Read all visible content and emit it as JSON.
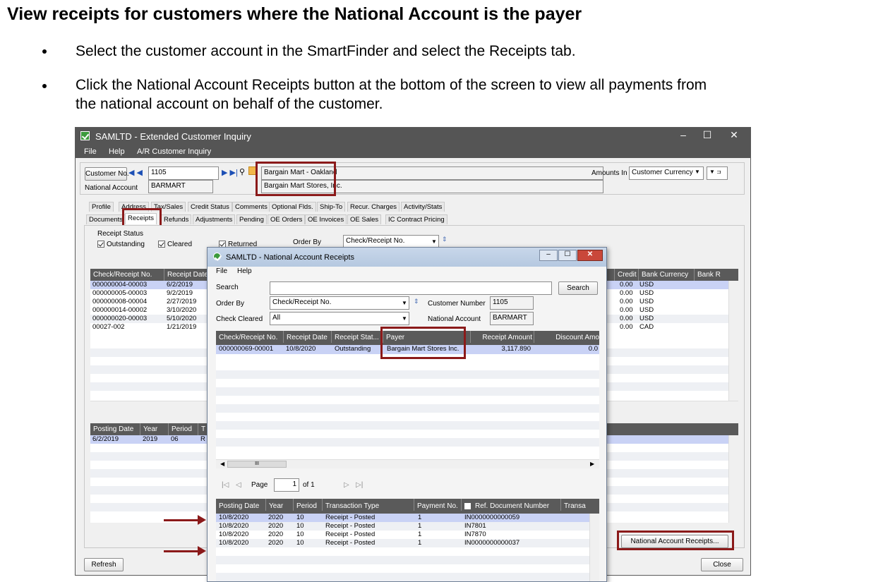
{
  "doc": {
    "title": "View receipts for customers where the National Account is the payer",
    "bullets": [
      "Select the customer account in the SmartFinder and select the Receipts tab.",
      "Click the National Account Receipts button at the bottom of the screen to view all payments from",
      "the national account on behalf of the customer."
    ]
  },
  "main": {
    "title": "SAMLTD - Extended Customer Inquiry",
    "menu": [
      "File",
      "Help",
      "A/R Customer Inquiry"
    ],
    "customer_no_label": "Customer No.",
    "customer_no": "1105",
    "customer_name": "Bargain Mart - Oakland",
    "national_account_label": "National Account",
    "national_account": "BARMART",
    "national_account_name": "Bargain Mart Stores, Inc.",
    "amounts_in_label": "Amounts In",
    "amounts_in": "Customer Currency",
    "tabs_row1": [
      "Profile",
      "Address",
      "Tax/Sales",
      "Credit Status",
      "Comments",
      "Optional Flds.",
      "Ship-To",
      "Recur. Charges",
      "Activity/Stats"
    ],
    "tabs_row2": [
      "Documents",
      "Receipts",
      "Refunds",
      "Adjustments",
      "Pending",
      "OE Orders",
      "OE Invoices",
      "OE Sales",
      "IC Contract Pricing"
    ],
    "receipt_status_label": "Receipt Status",
    "status_checks": [
      "Outstanding",
      "Cleared",
      "Returned"
    ],
    "order_by_label": "Order By",
    "order_by": "Check/Receipt No.",
    "grid_headers": [
      "Check/Receipt No.",
      "Receipt Date"
    ],
    "grid_headers_right": [
      "Credit",
      "Bank Currency",
      "Bank R"
    ],
    "receipts": [
      {
        "no": "000000004-00003",
        "date": "6/2/2019",
        "credit": "0.00",
        "currency": "USD"
      },
      {
        "no": "000000005-00003",
        "date": "9/2/2019",
        "credit": "0.00",
        "currency": "USD"
      },
      {
        "no": "000000008-00004",
        "date": "2/27/2019",
        "credit": "0.00",
        "currency": "USD"
      },
      {
        "no": "000000014-00002",
        "date": "3/10/2020",
        "credit": "0.00",
        "currency": "USD"
      },
      {
        "no": "000000020-00003",
        "date": "5/10/2020",
        "credit": "0.00",
        "currency": "USD"
      },
      {
        "no": "00027-002",
        "date": "1/21/2019",
        "credit": "0.00",
        "currency": "CAD"
      }
    ],
    "posting_headers": [
      "Posting Date",
      "Year",
      "Period",
      "T"
    ],
    "posting_rows": [
      {
        "date": "6/2/2019",
        "year": "2019",
        "period": "06",
        "t": "R"
      }
    ],
    "national_receipts_button": "National Account Receipts...",
    "refresh_button": "Refresh",
    "close_button": "Close"
  },
  "popup": {
    "title": "SAMLTD - National Account Receipts",
    "menu": [
      "File",
      "Help"
    ],
    "search_label": "Search",
    "search_value": "",
    "search_button": "Search",
    "order_by_label": "Order By",
    "order_by": "Check/Receipt No.",
    "check_cleared_label": "Check Cleared",
    "check_cleared": "All",
    "customer_number_label": "Customer Number",
    "customer_number": "1105",
    "national_account_label": "National Account",
    "national_account": "BARMART",
    "grid_headers": [
      "Check/Receipt No.",
      "Receipt Date",
      "Receipt Stat...",
      "Payer",
      "Receipt Amount",
      "Discount Amo"
    ],
    "rows": [
      {
        "no": "000000069-00001",
        "date": "10/8/2020",
        "status": "Outstanding",
        "payer": "Bargain Mart Stores Inc.",
        "amount": "3,117.890",
        "discount": "0.0"
      }
    ],
    "hscroll_mark": "III",
    "page_label": "Page",
    "page": "1",
    "of_label": "of 1",
    "detail_headers": [
      "Posting Date",
      "Year",
      "Period",
      "Transaction Type",
      "Payment No.",
      "Ref. Document Number",
      "Transa"
    ],
    "detail_rows": [
      {
        "date": "10/8/2020",
        "year": "2020",
        "period": "10",
        "type": "Receipt - Posted",
        "pay": "1",
        "ref": "IN0000000000059"
      },
      {
        "date": "10/8/2020",
        "year": "2020",
        "period": "10",
        "type": "Receipt - Posted",
        "pay": "1",
        "ref": "IN7801"
      },
      {
        "date": "10/8/2020",
        "year": "2020",
        "period": "10",
        "type": "Receipt - Posted",
        "pay": "1",
        "ref": "IN7870"
      },
      {
        "date": "10/8/2020",
        "year": "2020",
        "period": "10",
        "type": "Receipt - Posted",
        "pay": "1",
        "ref": "IN0000000000037"
      }
    ]
  },
  "colors": {
    "highlight": "#8b1a1a",
    "titlebar": "#555555"
  }
}
